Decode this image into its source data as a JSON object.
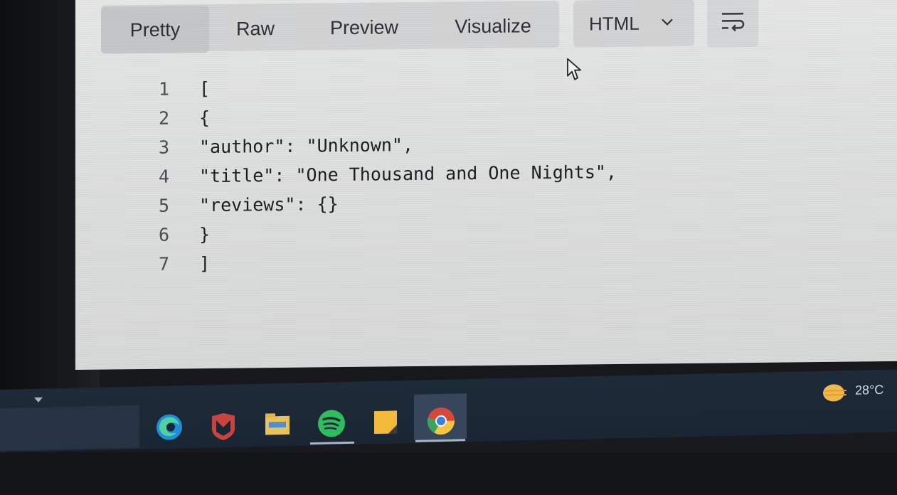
{
  "tabs": [
    {
      "label": "Pretty",
      "active": true
    },
    {
      "label": "Raw",
      "active": false
    },
    {
      "label": "Preview",
      "active": false
    },
    {
      "label": "Visualize",
      "active": false
    }
  ],
  "format": {
    "selected": "HTML",
    "chevron_icon": "chevron-down-icon"
  },
  "wrap_icon": "wrap-lines-icon",
  "code_lines": [
    {
      "num": "1",
      "text": "["
    },
    {
      "num": "2",
      "text": "{"
    },
    {
      "num": "3",
      "text": "\"author\": \"Unknown\","
    },
    {
      "num": "4",
      "text": "\"title\": \"One Thousand and One Nights\","
    },
    {
      "num": "5",
      "text": "\"reviews\": {}"
    },
    {
      "num": "6",
      "text": "}"
    },
    {
      "num": "7",
      "text": "]"
    }
  ],
  "taskbar": {
    "icons": [
      "edge-icon",
      "mcafee-icon",
      "file-explorer-icon",
      "spotify-icon",
      "sticky-notes-icon",
      "chrome-icon"
    ],
    "active_app": "chrome-icon",
    "temperature": "28°C"
  },
  "colors": {
    "screen_bg": "#dedfdf",
    "tab_group_bg": "#d3d4d5",
    "active_tab_bg": "#c5c7c9",
    "taskbar_bg": "#1d2a38"
  }
}
